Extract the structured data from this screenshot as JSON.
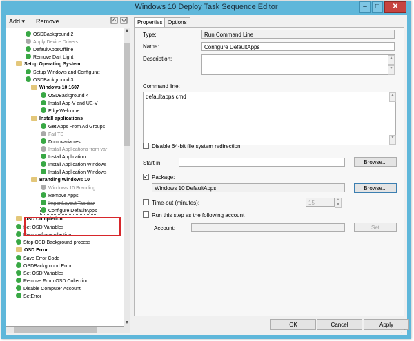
{
  "window": {
    "title": "Windows 10 Deploy Task Sequence Editor",
    "min_label": "–",
    "max_label": "□",
    "close_label": "✕"
  },
  "toolbar": {
    "add_label": "Add ▾",
    "remove_label": "Remove",
    "icon_left": "move-up-icon",
    "icon_right": "move-down-icon"
  },
  "tree": [
    {
      "label": "OSDBackground 2",
      "state": "ok"
    },
    {
      "label": "Apply Device Drivers",
      "state": "disabled"
    },
    {
      "label": "DefaultAppsOffline",
      "state": "ok"
    },
    {
      "label": "Remove Dart Light",
      "state": "ok"
    },
    {
      "label": "Setup Operating System",
      "state": "group"
    },
    {
      "label": "Setup Windows and Configurat",
      "state": "ok"
    },
    {
      "label": "OSDBackground 3",
      "state": "ok"
    },
    {
      "label": "Windows 10 1607",
      "state": "group"
    },
    {
      "label": "OSDBackground 4",
      "state": "ok"
    },
    {
      "label": "Install App-V and UE-V",
      "state": "ok"
    },
    {
      "label": "EdgeWelcome",
      "state": "ok"
    },
    {
      "label": "Install applications",
      "state": "group"
    },
    {
      "label": "Get Apps From Ad Groups",
      "state": "ok"
    },
    {
      "label": "Fail TS",
      "state": "disabled"
    },
    {
      "label": "Dumpvariables",
      "state": "ok"
    },
    {
      "label": "Install Applications from var",
      "state": "disabled"
    },
    {
      "label": "Install Application",
      "state": "ok"
    },
    {
      "label": "Install Application Windows",
      "state": "ok"
    },
    {
      "label": "Install Application Windows",
      "state": "ok"
    },
    {
      "label": "Branding Windows 10",
      "state": "group"
    },
    {
      "label": "Windows 10 Branding",
      "state": "disabled"
    },
    {
      "label": "Remove Apps",
      "state": "ok"
    },
    {
      "label": "ImportLayout Taskbar",
      "state": "strike"
    },
    {
      "label": "Configure DefaultApps",
      "state": "selected"
    },
    {
      "label": "OSD Completion",
      "state": "group"
    },
    {
      "label": "Set OSD Variables",
      "state": "ok"
    },
    {
      "label": "Removefromcollection",
      "state": "ok"
    },
    {
      "label": "Stop OSD Background process",
      "state": "ok"
    },
    {
      "label": "OSD Error",
      "state": "group"
    },
    {
      "label": "Save Error Code",
      "state": "ok"
    },
    {
      "label": "OSDBackground Error",
      "state": "ok"
    },
    {
      "label": "Set OSD Variables",
      "state": "ok"
    },
    {
      "label": "Remove From OSD Collection",
      "state": "ok"
    },
    {
      "label": "Disable Computer Account",
      "state": "ok"
    },
    {
      "label": "SetError",
      "state": "ok"
    }
  ],
  "tabs": {
    "properties": "Properties",
    "options": "Options"
  },
  "properties": {
    "type_label": "Type:",
    "type_value": "Run Command Line",
    "name_label": "Name:",
    "name_value": "Configure DefaultApps",
    "description_label": "Description:",
    "description_value": "",
    "command_label": "Command line:",
    "command_value": "defaultapps.cmd",
    "disable64_label": "Disable 64-bit file system redirection",
    "startin_label": "Start in:",
    "startin_value": "",
    "browse_label": "Browse...",
    "package_label": "Package:",
    "package_value": "Windows 10 DefaultApps",
    "package_browse_label": "Browse...",
    "timeout_label": "Time-out (minutes):",
    "timeout_value": "15",
    "runas_label": "Run this step as the following account",
    "account_label": "Account:",
    "account_value": "",
    "set_label": "Set"
  },
  "buttons": {
    "ok": "OK",
    "cancel": "Cancel",
    "apply": "Apply"
  },
  "colors": {
    "accent": "#5fb7da",
    "ok_icon": "#39a845",
    "highlight": "#d7272b"
  }
}
